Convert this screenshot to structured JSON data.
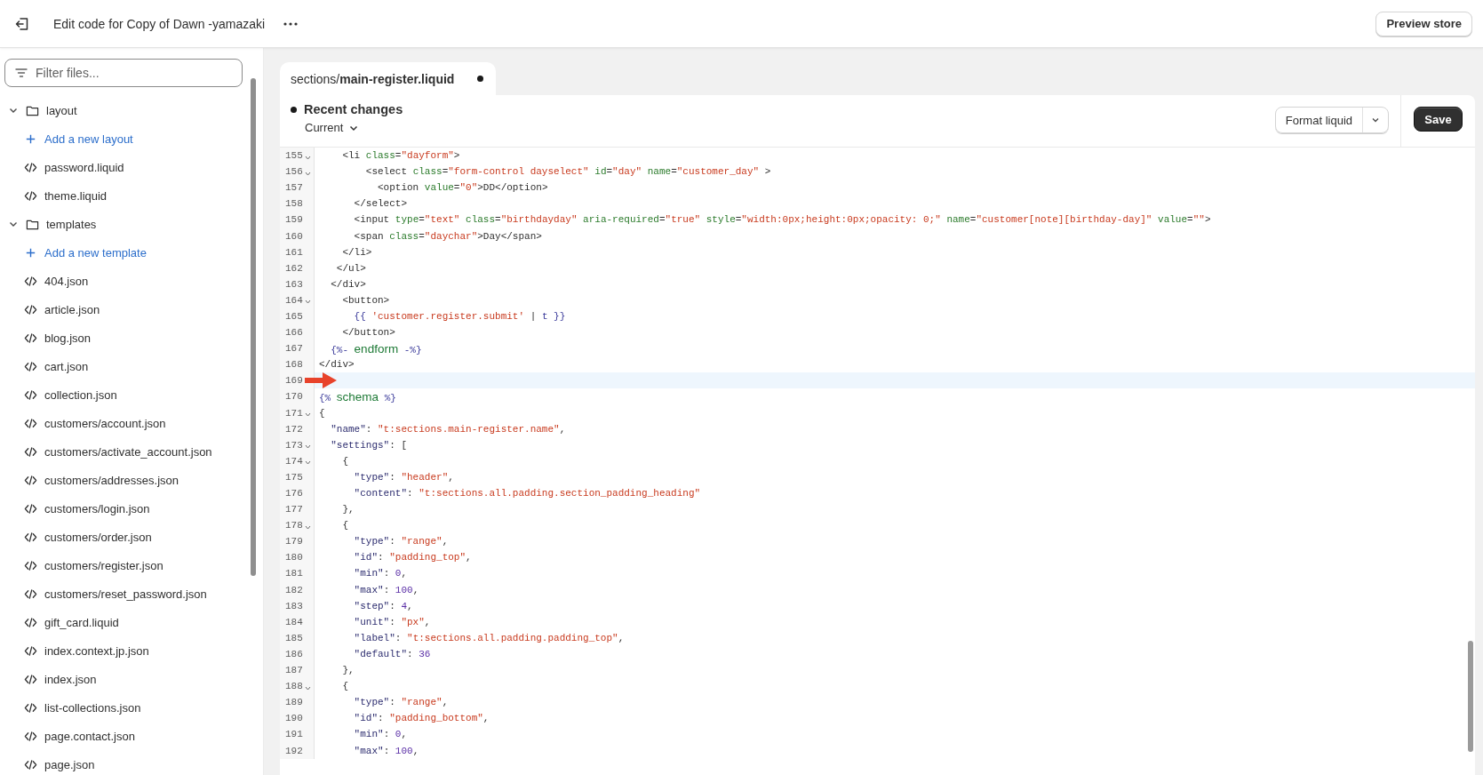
{
  "topbar": {
    "title": "Edit code for Copy of Dawn -yamazaki",
    "preview_button": "Preview store"
  },
  "sidebar": {
    "filter_placeholder": "Filter files...",
    "tree": [
      {
        "kind": "folder",
        "label": "layout",
        "expanded": true,
        "children": [
          {
            "kind": "add",
            "label": "Add a new layout"
          },
          {
            "kind": "file",
            "label": "password.liquid"
          },
          {
            "kind": "file",
            "label": "theme.liquid"
          }
        ]
      },
      {
        "kind": "folder",
        "label": "templates",
        "expanded": true,
        "children": [
          {
            "kind": "add",
            "label": "Add a new template"
          },
          {
            "kind": "file",
            "label": "404.json"
          },
          {
            "kind": "file",
            "label": "article.json"
          },
          {
            "kind": "file",
            "label": "blog.json"
          },
          {
            "kind": "file",
            "label": "cart.json"
          },
          {
            "kind": "file",
            "label": "collection.json"
          },
          {
            "kind": "file",
            "label": "customers/account.json"
          },
          {
            "kind": "file",
            "label": "customers/activate_account.json"
          },
          {
            "kind": "file",
            "label": "customers/addresses.json"
          },
          {
            "kind": "file",
            "label": "customers/login.json"
          },
          {
            "kind": "file",
            "label": "customers/order.json"
          },
          {
            "kind": "file",
            "label": "customers/register.json"
          },
          {
            "kind": "file",
            "label": "customers/reset_password.json"
          },
          {
            "kind": "file",
            "label": "gift_card.liquid"
          },
          {
            "kind": "file",
            "label": "index.context.jp.json"
          },
          {
            "kind": "file",
            "label": "index.json"
          },
          {
            "kind": "file",
            "label": "list-collections.json"
          },
          {
            "kind": "file",
            "label": "page.contact.json"
          },
          {
            "kind": "file",
            "label": "page.json"
          }
        ]
      }
    ]
  },
  "editor": {
    "tab": {
      "label": "sections/**main-register.liquid**",
      "selected": true,
      "modified": true
    },
    "changes_label": "Recent changes",
    "version_label": "Current",
    "format_button": "Format liquid",
    "save_button": "Save",
    "lines": [
      {
        "number": "155",
        "foldable": true,
        "current": false,
        "tokens": [
          {
            "kind": "plain",
            "text": "    <li "
          },
          {
            "kind": "attr",
            "text": "class"
          },
          {
            "kind": "plain",
            "text": "="
          },
          {
            "kind": "string",
            "text": "\"dayform\""
          },
          {
            "kind": "plain",
            "text": ">"
          }
        ]
      },
      {
        "number": "156",
        "foldable": true,
        "current": false,
        "tokens": [
          {
            "kind": "plain",
            "text": "        <select "
          },
          {
            "kind": "attr",
            "text": "class"
          },
          {
            "kind": "plain",
            "text": "="
          },
          {
            "kind": "string",
            "text": "\"form-control dayselect\""
          },
          {
            "kind": "attr",
            "text": " id"
          },
          {
            "kind": "plain",
            "text": "="
          },
          {
            "kind": "string",
            "text": "\"day\""
          },
          {
            "kind": "attr",
            "text": " name"
          },
          {
            "kind": "plain",
            "text": "="
          },
          {
            "kind": "string",
            "text": "\"customer_day\""
          },
          {
            "kind": "plain",
            "text": " >"
          }
        ]
      },
      {
        "number": "157",
        "foldable": false,
        "current": false,
        "tokens": [
          {
            "kind": "plain",
            "text": "          <option "
          },
          {
            "kind": "attr",
            "text": "value"
          },
          {
            "kind": "plain",
            "text": "="
          },
          {
            "kind": "string",
            "text": "\"0\""
          },
          {
            "kind": "plain",
            "text": ">DD</option>"
          }
        ]
      },
      {
        "number": "158",
        "foldable": false,
        "current": false,
        "tokens": [
          {
            "kind": "plain",
            "text": "      </select>"
          }
        ]
      },
      {
        "number": "159",
        "foldable": false,
        "current": false,
        "tokens": [
          {
            "kind": "plain",
            "text": "      <input "
          },
          {
            "kind": "attr",
            "text": "type"
          },
          {
            "kind": "plain",
            "text": "="
          },
          {
            "kind": "string",
            "text": "\"text\""
          },
          {
            "kind": "attr",
            "text": " class"
          },
          {
            "kind": "plain",
            "text": "="
          },
          {
            "kind": "string",
            "text": "\"birthdayday\""
          },
          {
            "kind": "attr",
            "text": " aria-required"
          },
          {
            "kind": "plain",
            "text": "="
          },
          {
            "kind": "string",
            "text": "\"true\""
          },
          {
            "kind": "attr",
            "text": " style"
          },
          {
            "kind": "plain",
            "text": "="
          },
          {
            "kind": "string",
            "text": "\"width:0px;height:0px;opacity: 0;\""
          },
          {
            "kind": "attr",
            "text": " name"
          },
          {
            "kind": "plain",
            "text": "="
          },
          {
            "kind": "string",
            "text": "\"customer[note][birthday-day]\""
          },
          {
            "kind": "attr",
            "text": " value"
          },
          {
            "kind": "plain",
            "text": "="
          },
          {
            "kind": "string",
            "text": "\"\""
          },
          {
            "kind": "plain",
            "text": ">"
          }
        ]
      },
      {
        "number": "160",
        "foldable": false,
        "current": false,
        "tokens": [
          {
            "kind": "plain",
            "text": "      <span "
          },
          {
            "kind": "attr",
            "text": "class"
          },
          {
            "kind": "plain",
            "text": "="
          },
          {
            "kind": "string",
            "text": "\"daychar\""
          },
          {
            "kind": "plain",
            "text": ">Day</span>"
          }
        ]
      },
      {
        "number": "161",
        "foldable": false,
        "current": false,
        "tokens": [
          {
            "kind": "plain",
            "text": "    </li>"
          }
        ]
      },
      {
        "number": "162",
        "foldable": false,
        "current": false,
        "tokens": [
          {
            "kind": "plain",
            "text": "   </ul>"
          }
        ]
      },
      {
        "number": "163",
        "foldable": false,
        "current": false,
        "tokens": [
          {
            "kind": "plain",
            "text": "  </div>"
          }
        ]
      },
      {
        "number": "164",
        "foldable": true,
        "current": false,
        "tokens": [
          {
            "kind": "plain",
            "text": "    <button>"
          }
        ]
      },
      {
        "number": "165",
        "foldable": false,
        "current": false,
        "tokens": [
          {
            "kind": "liquid",
            "text": "      {{ "
          },
          {
            "kind": "string",
            "text": "'customer.register.submit'"
          },
          {
            "kind": "plain",
            "text": " | "
          },
          {
            "kind": "liquid",
            "text": "t }}"
          }
        ]
      },
      {
        "number": "166",
        "foldable": false,
        "current": false,
        "tokens": [
          {
            "kind": "plain",
            "text": "    </button>"
          }
        ]
      },
      {
        "number": "167",
        "foldable": false,
        "current": false,
        "tokens": [
          {
            "kind": "liquid",
            "text": "  {%- "
          },
          {
            "kind": "keyword",
            "text": "endform"
          },
          {
            "kind": "liquid",
            "text": " -%}"
          }
        ]
      },
      {
        "number": "168",
        "foldable": false,
        "current": false,
        "tokens": [
          {
            "kind": "plain",
            "text": "</div>"
          }
        ]
      },
      {
        "number": "169",
        "foldable": false,
        "current": true
      },
      {
        "number": "170",
        "foldable": false,
        "current": false,
        "tokens": [
          {
            "kind": "liquid",
            "text": "{% "
          },
          {
            "kind": "keyword",
            "text": "schema"
          },
          {
            "kind": "liquid",
            "text": " %}"
          }
        ]
      },
      {
        "number": "171",
        "foldable": true,
        "current": false,
        "tokens": [
          {
            "kind": "plain",
            "text": "{"
          }
        ]
      },
      {
        "number": "172",
        "foldable": false,
        "current": false,
        "tokens": [
          {
            "kind": "key",
            "text": "  \"name\""
          },
          {
            "kind": "plain",
            "text": ": "
          },
          {
            "kind": "string",
            "text": "\"t:sections.main-register.name\""
          },
          {
            "kind": "plain",
            "text": ","
          }
        ]
      },
      {
        "number": "173",
        "foldable": true,
        "current": false,
        "tokens": [
          {
            "kind": "key",
            "text": "  \"settings\""
          },
          {
            "kind": "plain",
            "text": ": ["
          }
        ]
      },
      {
        "number": "174",
        "foldable": true,
        "current": false,
        "tokens": [
          {
            "kind": "plain",
            "text": "    {"
          }
        ]
      },
      {
        "number": "175",
        "foldable": false,
        "current": false,
        "tokens": [
          {
            "kind": "key",
            "text": "      \"type\""
          },
          {
            "kind": "plain",
            "text": ": "
          },
          {
            "kind": "string",
            "text": "\"header\""
          },
          {
            "kind": "plain",
            "text": ","
          }
        ]
      },
      {
        "number": "176",
        "foldable": false,
        "current": false,
        "tokens": [
          {
            "kind": "key",
            "text": "      \"content\""
          },
          {
            "kind": "plain",
            "text": ": "
          },
          {
            "kind": "string",
            "text": "\"t:sections.all.padding.section_padding_heading\""
          }
        ]
      },
      {
        "number": "177",
        "foldable": false,
        "current": false,
        "tokens": [
          {
            "kind": "plain",
            "text": "    },"
          }
        ]
      },
      {
        "number": "178",
        "foldable": true,
        "current": false,
        "tokens": [
          {
            "kind": "plain",
            "text": "    {"
          }
        ]
      },
      {
        "number": "179",
        "foldable": false,
        "current": false,
        "tokens": [
          {
            "kind": "key",
            "text": "      \"type\""
          },
          {
            "kind": "plain",
            "text": ": "
          },
          {
            "kind": "string",
            "text": "\"range\""
          },
          {
            "kind": "plain",
            "text": ","
          }
        ]
      },
      {
        "number": "180",
        "foldable": false,
        "current": false,
        "tokens": [
          {
            "kind": "key",
            "text": "      \"id\""
          },
          {
            "kind": "plain",
            "text": ": "
          },
          {
            "kind": "string",
            "text": "\"padding_top\""
          },
          {
            "kind": "plain",
            "text": ","
          }
        ]
      },
      {
        "number": "181",
        "foldable": false,
        "current": false,
        "tokens": [
          {
            "kind": "key",
            "text": "      \"min\""
          },
          {
            "kind": "plain",
            "text": ": "
          },
          {
            "kind": "number",
            "text": "0"
          },
          {
            "kind": "plain",
            "text": ","
          }
        ]
      },
      {
        "number": "182",
        "foldable": false,
        "current": false,
        "tokens": [
          {
            "kind": "key",
            "text": "      \"max\""
          },
          {
            "kind": "plain",
            "text": ": "
          },
          {
            "kind": "number",
            "text": "100"
          },
          {
            "kind": "plain",
            "text": ","
          }
        ]
      },
      {
        "number": "183",
        "foldable": false,
        "current": false,
        "tokens": [
          {
            "kind": "key",
            "text": "      \"step\""
          },
          {
            "kind": "plain",
            "text": ": "
          },
          {
            "kind": "number",
            "text": "4"
          },
          {
            "kind": "plain",
            "text": ","
          }
        ]
      },
      {
        "number": "184",
        "foldable": false,
        "current": false,
        "tokens": [
          {
            "kind": "key",
            "text": "      \"unit\""
          },
          {
            "kind": "plain",
            "text": ": "
          },
          {
            "kind": "string",
            "text": "\"px\""
          },
          {
            "kind": "plain",
            "text": ","
          }
        ]
      },
      {
        "number": "185",
        "foldable": false,
        "current": false,
        "tokens": [
          {
            "kind": "key",
            "text": "      \"label\""
          },
          {
            "kind": "plain",
            "text": ": "
          },
          {
            "kind": "string",
            "text": "\"t:sections.all.padding.padding_top\""
          },
          {
            "kind": "plain",
            "text": ","
          }
        ]
      },
      {
        "number": "186",
        "foldable": false,
        "current": false,
        "tokens": [
          {
            "kind": "key",
            "text": "      \"default\""
          },
          {
            "kind": "plain",
            "text": ": "
          },
          {
            "kind": "number",
            "text": "36"
          }
        ]
      },
      {
        "number": "187",
        "foldable": false,
        "current": false,
        "tokens": [
          {
            "kind": "plain",
            "text": "    },"
          }
        ]
      },
      {
        "number": "188",
        "foldable": true,
        "current": false,
        "tokens": [
          {
            "kind": "plain",
            "text": "    {"
          }
        ]
      },
      {
        "number": "189",
        "foldable": false,
        "current": false,
        "tokens": [
          {
            "kind": "key",
            "text": "      \"type\""
          },
          {
            "kind": "plain",
            "text": ": "
          },
          {
            "kind": "string",
            "text": "\"range\""
          },
          {
            "kind": "plain",
            "text": ","
          }
        ]
      },
      {
        "number": "190",
        "foldable": false,
        "current": false,
        "tokens": [
          {
            "kind": "key",
            "text": "      \"id\""
          },
          {
            "kind": "plain",
            "text": ": "
          },
          {
            "kind": "string",
            "text": "\"padding_bottom\""
          },
          {
            "kind": "plain",
            "text": ","
          }
        ]
      },
      {
        "number": "191",
        "foldable": false,
        "current": false,
        "tokens": [
          {
            "kind": "key",
            "text": "      \"min\""
          },
          {
            "kind": "plain",
            "text": ": "
          },
          {
            "kind": "number",
            "text": "0"
          },
          {
            "kind": "plain",
            "text": ","
          }
        ]
      },
      {
        "number": "192",
        "foldable": false,
        "current": false,
        "tokens": [
          {
            "kind": "key",
            "text": "      \"max\""
          },
          {
            "kind": "plain",
            "text": ": "
          },
          {
            "kind": "number",
            "text": "100"
          },
          {
            "kind": "plain",
            "text": ","
          }
        ]
      }
    ]
  }
}
